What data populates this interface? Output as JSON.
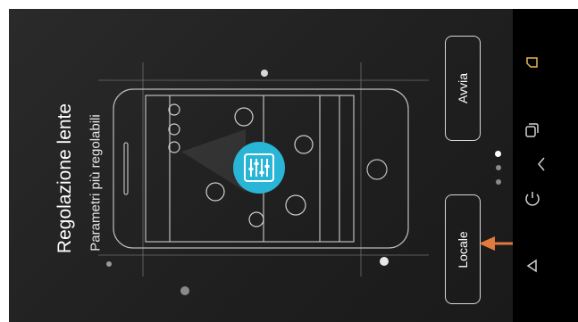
{
  "intro": {
    "title": "Regolazione lente",
    "subtitle": "Parametri più regolabili"
  },
  "buttons": {
    "start_label": "Avvia",
    "local_label": "Locale"
  },
  "pager": {
    "pages": 3,
    "active": 1
  },
  "colors": {
    "background": "#222222",
    "accent_teal": "#29b6d6",
    "annotation_arrow": "#e07a3e",
    "nav_icon": "#d0d0d0",
    "recents_icon": "#e8b84a"
  },
  "icons": [
    "app-logo-icon",
    "equalizer-icon",
    "recents-icon",
    "back-icon",
    "home-icon",
    "overview-icon",
    "arrow-annotation-icon"
  ]
}
